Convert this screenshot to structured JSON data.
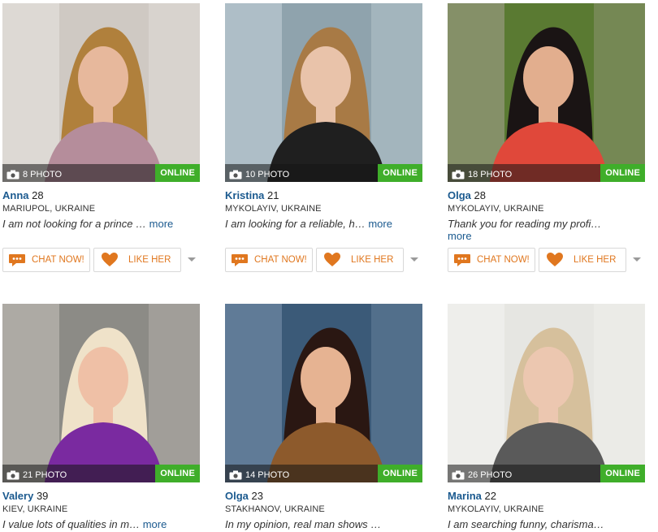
{
  "profiles": [
    {
      "name": "Anna",
      "age": "28",
      "location": "MARIUPOL, UKRAINE",
      "bio": "I am not looking for a prince …",
      "more": "more",
      "photo_count": "8 PHOTO",
      "status": "ONLINE",
      "show_actions": true,
      "colors": {
        "bg": "#cfc9c3",
        "stripe": "#e9e6e2",
        "hair": "#b0803c",
        "skin": "#e7b89c",
        "cloth": "#b58d9b"
      }
    },
    {
      "name": "Kristina",
      "age": "21",
      "location": "MYKOLAYIV, UKRAINE",
      "bio": "I am looking for a reliable, h…",
      "more": "more",
      "photo_count": "10 PHOTO",
      "status": "ONLINE",
      "show_actions": true,
      "colors": {
        "bg": "#8fa3ad",
        "stripe": "#c8d6dc",
        "hair": "#a87a45",
        "skin": "#e9c3aa",
        "cloth": "#1f1f1f"
      }
    },
    {
      "name": "Olga",
      "age": "28",
      "location": "MYKOLAYIV, UKRAINE",
      "bio": "Thank you for reading my profi…",
      "more": "more",
      "photo_count": "18 PHOTO",
      "status": "ONLINE",
      "show_actions": true,
      "colors": {
        "bg": "#5a7a32",
        "stripe": "#a9a296",
        "hair": "#1a1414",
        "skin": "#e2ae8e",
        "cloth": "#e0483a"
      }
    },
    {
      "name": "Valery",
      "age": "39",
      "location": "KIEV, UKRAINE",
      "bio": "I value lots of qualities in m…",
      "more": "more",
      "photo_count": "21 PHOTO",
      "status": "ONLINE",
      "show_actions": false,
      "colors": {
        "bg": "#8c8b86",
        "stripe": "#c9c4bd",
        "hair": "#efe2c9",
        "skin": "#efc0a6",
        "cloth": "#7a2aa0"
      }
    },
    {
      "name": "Olga",
      "age": "23",
      "location": "STAKHANOV, UKRAINE",
      "bio": "In my opinion, real man shows …",
      "more": "",
      "photo_count": "14 PHOTO",
      "status": "ONLINE",
      "show_actions": false,
      "colors": {
        "bg": "#3b5a78",
        "stripe": "#7f98b0",
        "hair": "#2a1712",
        "skin": "#e6b392",
        "cloth": "#8d5a2c"
      }
    },
    {
      "name": "Marina",
      "age": "22",
      "location": "MYKOLAYIV, UKRAINE",
      "bio": "I am searching funny, charisma…",
      "more": "",
      "photo_count": "26 PHOTO",
      "status": "ONLINE",
      "show_actions": false,
      "colors": {
        "bg": "#e6e6e2",
        "stripe": "#f4f4f2",
        "hair": "#d6c09c",
        "skin": "#ecc7b0",
        "cloth": "#5a5a5a"
      }
    }
  ],
  "actions": {
    "chat_label": "CHAT NOW!",
    "like_label": "LIKE HER"
  },
  "theme": {
    "accent": "#e0771f",
    "link": "#1b5a8f",
    "online": "#3fae2a"
  },
  "icons": {
    "photo": "camera-icon",
    "chat": "chat-bubble-icon",
    "like": "heart-icon",
    "dropdown": "chevron-down-icon"
  }
}
